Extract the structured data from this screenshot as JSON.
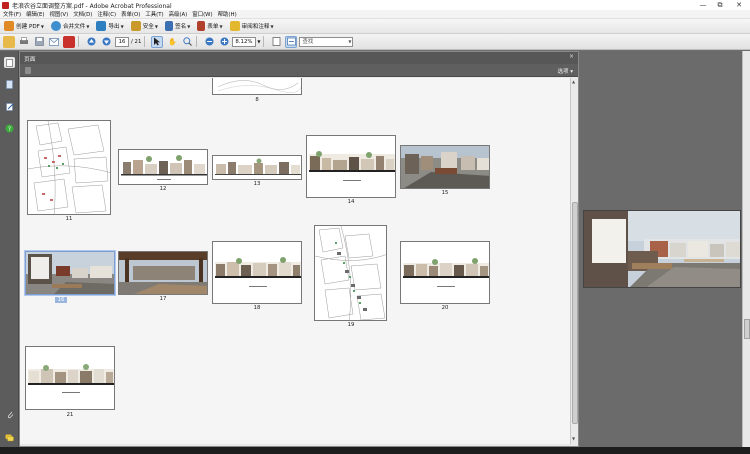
{
  "window": {
    "title": "老浪农谷立面调整方案.pdf - Adobe Acrobat Professional",
    "controls": [
      "—",
      "⧉",
      "✕"
    ]
  },
  "menu": [
    "文件(F)",
    "编辑(E)",
    "视图(V)",
    "文档(D)",
    "注释(C)",
    "表单(O)",
    "工具(T)",
    "高级(A)",
    "窗口(W)",
    "帮助(H)"
  ],
  "tasks": [
    {
      "label": "创建 PDF",
      "icon": "create-pdf-icon",
      "color": "#e08a25"
    },
    {
      "label": "合并文件",
      "icon": "combine-files-icon",
      "color": "#3d8fd0"
    },
    {
      "label": "导出",
      "icon": "export-icon",
      "color": "#2e7fbf"
    },
    {
      "label": "安全",
      "icon": "lock-icon",
      "color": "#c99a2a"
    },
    {
      "label": "签名",
      "icon": "pen-icon",
      "color": "#3b6fb2"
    },
    {
      "label": "表单",
      "icon": "form-icon",
      "color": "#b0402c"
    },
    {
      "label": "审阅和注释",
      "icon": "comment-icon",
      "color": "#e3b82f"
    }
  ],
  "toolbar": {
    "current_page": "16",
    "page_count": "/ 21",
    "zoom": "8.12%",
    "find_placeholder": "查找"
  },
  "panel": {
    "title": "页面",
    "options": "选项",
    "close": "×"
  },
  "thumbnails": [
    {
      "label": "8"
    },
    {
      "label": "11"
    },
    {
      "label": "12"
    },
    {
      "label": "13"
    },
    {
      "label": "14"
    },
    {
      "label": "15"
    },
    {
      "label": "16"
    },
    {
      "label": "17"
    },
    {
      "label": "18"
    },
    {
      "label": "19"
    },
    {
      "label": "20"
    },
    {
      "label": "21"
    }
  ],
  "selected_page": "16",
  "colors": {
    "accent": "#7b9ed3",
    "panel_header": "#575757",
    "document_bg": "#6b6b6b"
  }
}
